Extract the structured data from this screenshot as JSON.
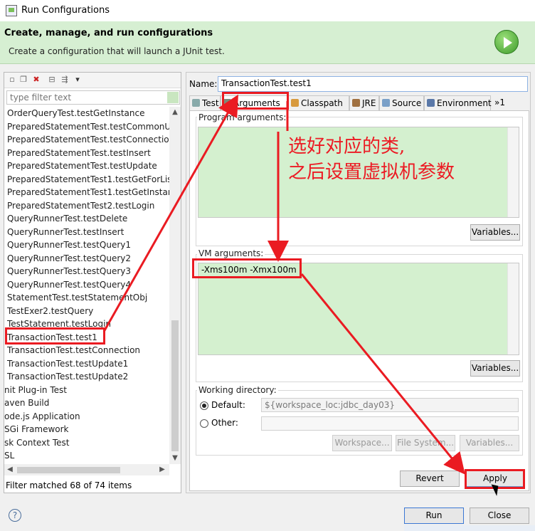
{
  "window": {
    "title": "Run Configurations"
  },
  "header": {
    "title": "Create, manage, and run configurations",
    "subtitle": "Create a configuration that will launch a JUnit test."
  },
  "left": {
    "filter_placeholder": "type filter text",
    "items": [
      "OrderQueryTest.testGetInstance",
      "PreparedStatementTest.testCommonU",
      "PreparedStatementTest.testConnectio",
      "PreparedStatementTest.testInsert",
      "PreparedStatementTest.testUpdate",
      "PreparedStatementTest1.testGetForLis",
      "PreparedStatementTest1.testGetInstar",
      "PreparedStatementTest2.testLogin",
      "QueryRunnerTest.testDelete",
      "QueryRunnerTest.testInsert",
      "QueryRunnerTest.testQuery1",
      "QueryRunnerTest.testQuery2",
      "QueryRunnerTest.testQuery3",
      "QueryRunnerTest.testQuery4",
      "StatementTest.testStatementObj",
      "TestExer2.testQuery",
      "TestStatement.testLogin",
      "TransactionTest.test1",
      "TransactionTest.testConnection",
      "TransactionTest.testUpdate1",
      "TransactionTest.testUpdate2",
      "nit Plug-in Test",
      "aven Build",
      "ode.js Application",
      "SGi Framework",
      "sk Context Test",
      "SL"
    ],
    "status": "Filter matched 68 of 74 items"
  },
  "right": {
    "name_label": "Name:",
    "name_value": "TransactionTest.test1",
    "tabs": [
      "Test",
      "Arguments",
      "Classpath",
      "JRE",
      "Source",
      "Environment",
      "»1"
    ],
    "program_args_label": "Program arguments:",
    "variables_btn": "Variables...",
    "vm_args_label": "VM arguments:",
    "vm_args_value": "-Xms100m -Xmx100m",
    "working_dir_label": "Working directory:",
    "default_label": "Default:",
    "default_value": "${workspace_loc:jdbc_day03}",
    "other_label": "Other:",
    "workspace_btn": "Workspace...",
    "filesystem_btn": "File System...",
    "revert_btn": "Revert",
    "apply_btn": "Apply"
  },
  "footer": {
    "run_btn": "Run",
    "close_btn": "Close",
    "help_icon": "?"
  },
  "annotation": {
    "line1": "选好对应的类,",
    "line2": "之后设置虚拟机参数",
    "color": "#ea1b22"
  }
}
